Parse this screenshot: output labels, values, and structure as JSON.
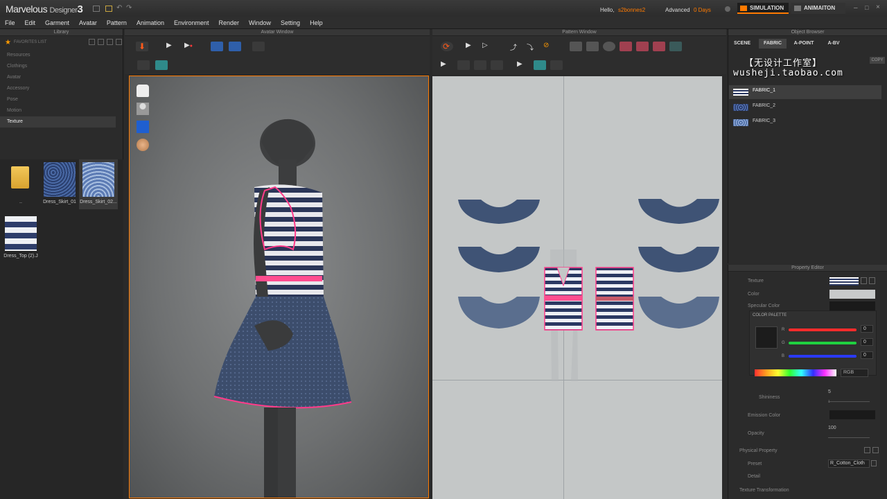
{
  "app": {
    "logo": "Marvelous",
    "logo_sub": "Designer",
    "version": "3",
    "hello": "Hello,",
    "username": "s2bonnes2",
    "license": "Advanced",
    "days": "0 Days",
    "mode_simulation": "SIMULATION",
    "mode_animation": "ANIMAITON"
  },
  "menu": [
    "File",
    "Edit",
    "Garment",
    "Avatar",
    "Pattern",
    "Animation",
    "Environment",
    "Render",
    "Window",
    "Setting",
    "Help"
  ],
  "library": {
    "title": "Library",
    "favorites": "FAVORITES LIST",
    "items": [
      "Resources",
      "Clothings",
      "Avatar",
      "Accessory",
      "Pose",
      "Motion",
      "Texture"
    ],
    "selected": "Texture",
    "thumbs": [
      {
        "label": ".."
      },
      {
        "label": "Dress_Skirt_01"
      },
      {
        "label": "Dress_Skirt_02..."
      },
      {
        "label": "Dress_Top (2).J"
      }
    ]
  },
  "avatar_window": {
    "title": "Avatar Window"
  },
  "pattern_window": {
    "title": "Pattern Window"
  },
  "object_browser": {
    "title": "Object Browser",
    "tabs": [
      "SCENE",
      "FABRIC",
      "A-POINT",
      "A-BV"
    ],
    "active_tab": "FABRIC",
    "copy_btn": "COPY",
    "fabrics": [
      "FABRIC_1",
      "FABRIC_2",
      "FABRIC_3"
    ],
    "selected_fabric": "FABRIC_1"
  },
  "watermark": {
    "line1": "【无设计工作室】",
    "line2": "wusheji.taobao.com"
  },
  "property_editor": {
    "title": "Property Editor",
    "texture": "Texture",
    "color": "Color",
    "specular": "Specular Color",
    "palette": "COLOR PALETTE",
    "r": "R",
    "g": "G",
    "b": "B",
    "r_val": "0",
    "g_val": "0",
    "b_val": "0",
    "mode": "RGB",
    "shininess": "Shininess",
    "shininess_val": "5",
    "shininess_min": "1",
    "emission": "Emission Color",
    "opacity": "Opacity",
    "opacity_val": "100",
    "physical": "Physical Property",
    "preset": "Preset",
    "preset_val": "R_Cotton_Cloth",
    "detail": "Detail",
    "texture_transform": "Texture Transformation"
  },
  "colors": {
    "accent": "#ff7a00",
    "navy": "#3c4d6c",
    "stripe_pink": "#ff3b8a"
  }
}
